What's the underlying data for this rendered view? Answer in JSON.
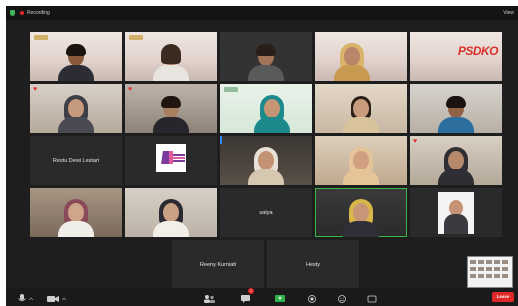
{
  "topbar": {
    "recording_label": "Recording",
    "view_label": "View"
  },
  "participants": {
    "name_tiles": [
      {
        "label": "Restu Dewi Lestari"
      },
      {
        "label": "satya"
      },
      {
        "label": "Reeny Kurniati"
      },
      {
        "label": "Hesty"
      }
    ],
    "banner_text": "PSDKO"
  },
  "toolbar": {
    "end_label": "Leave",
    "chat_badge": "1"
  },
  "colors": {
    "window_bg": "#1e1e1e",
    "accent_red": "#e02828",
    "banner_red": "#d8322b",
    "active_speaker": "#39b54a"
  }
}
